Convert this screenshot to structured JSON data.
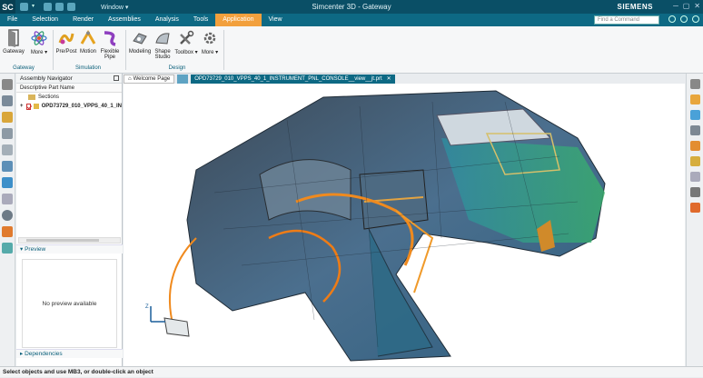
{
  "app": {
    "logo": "SC",
    "title": "Simcenter 3D - Gateway",
    "window_menu": "Window ▾",
    "brand": "SIEMENS"
  },
  "menu": {
    "items": [
      "File",
      "Selection",
      "Render",
      "Assemblies",
      "Analysis",
      "Tools",
      "Application",
      "View"
    ],
    "active": "Application",
    "search_placeholder": "Find a Command"
  },
  "ribbon": {
    "buttons": [
      {
        "label": "Gateway",
        "icon": "door-icon"
      },
      {
        "label": "More",
        "icon": "atom-icon"
      },
      {
        "label": "Pre/Post",
        "icon": "prepost-icon"
      },
      {
        "label": "Motion",
        "icon": "motion-icon"
      },
      {
        "label": "Flexible Pipe",
        "icon": "pipe-icon"
      },
      {
        "label": "Modeling",
        "icon": "modeling-icon"
      },
      {
        "label": "Shape Studio",
        "icon": "shape-studio-icon"
      },
      {
        "label": "Toolbox",
        "icon": "toolbox-icon"
      },
      {
        "label": "More",
        "icon": "more-gear-icon"
      }
    ],
    "groups": [
      "Gateway",
      "Simulation",
      "Design"
    ]
  },
  "tabs": {
    "welcome": "Welcome Page",
    "part": "OPD73729_010_VPPS_40_1_INSTRUMENT_PNL_CONSOLE__view__jt.prt"
  },
  "navigator": {
    "title": "Assembly Navigator",
    "column_header": "Descriptive Part Name",
    "rows": [
      "Sections",
      "OPD73729_010_VPPS_40_1_IN"
    ],
    "preview_header": "Preview",
    "preview_empty": "No preview available",
    "dependencies_header": "Dependencies"
  },
  "status": {
    "message": "Select objects and use MB3, or double-click an object"
  },
  "colors": {
    "title_bar": "#0a4f66",
    "menu_bar": "#0d6984",
    "active_tab": "#f2a03d"
  }
}
